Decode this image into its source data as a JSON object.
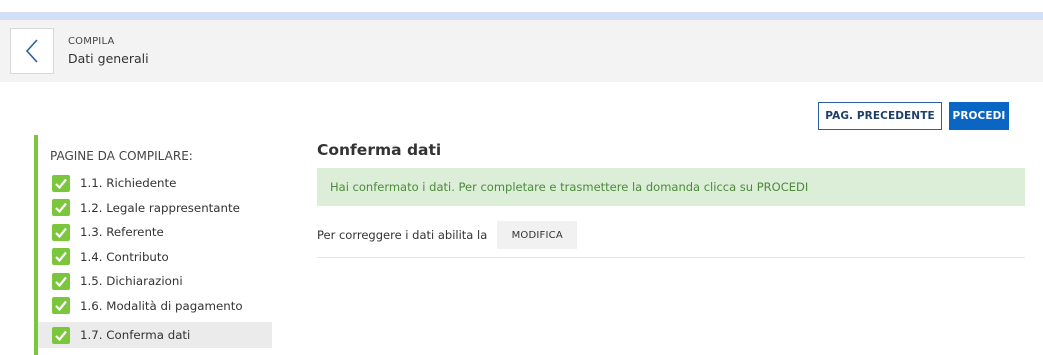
{
  "header": {
    "section": "COMPILA",
    "title": "Dati generali"
  },
  "toolbar": {
    "prev_label": "PAG. PRECEDENTE",
    "next_label": "PROCEDI"
  },
  "sidebar": {
    "heading": "PAGINE DA COMPILARE:",
    "items": [
      {
        "label": "1.1. Richiedente",
        "completed": true
      },
      {
        "label": "1.2. Legale rappresentante",
        "completed": true
      },
      {
        "label": "1.3. Referente",
        "completed": true
      },
      {
        "label": "1.4. Contributo",
        "completed": true
      },
      {
        "label": "1.5. Dichiarazioni",
        "completed": true
      },
      {
        "label": "1.6. Modalità di pagamento",
        "completed": true
      },
      {
        "label": "1.7. Conferma dati",
        "completed": true,
        "active": true
      }
    ]
  },
  "main": {
    "title": "Conferma dati",
    "alert": "Hai confermato i dati. Per completare e trasmettere la domanda clicca su PROCEDI",
    "fix_text": "Per correggere i dati abilita la",
    "modify_label": "MODIFICA"
  },
  "colors": {
    "accent": "#0b66c3",
    "success_bg": "#dcedd8",
    "success_text": "#4b8b3b",
    "check": "#7cc63d"
  }
}
